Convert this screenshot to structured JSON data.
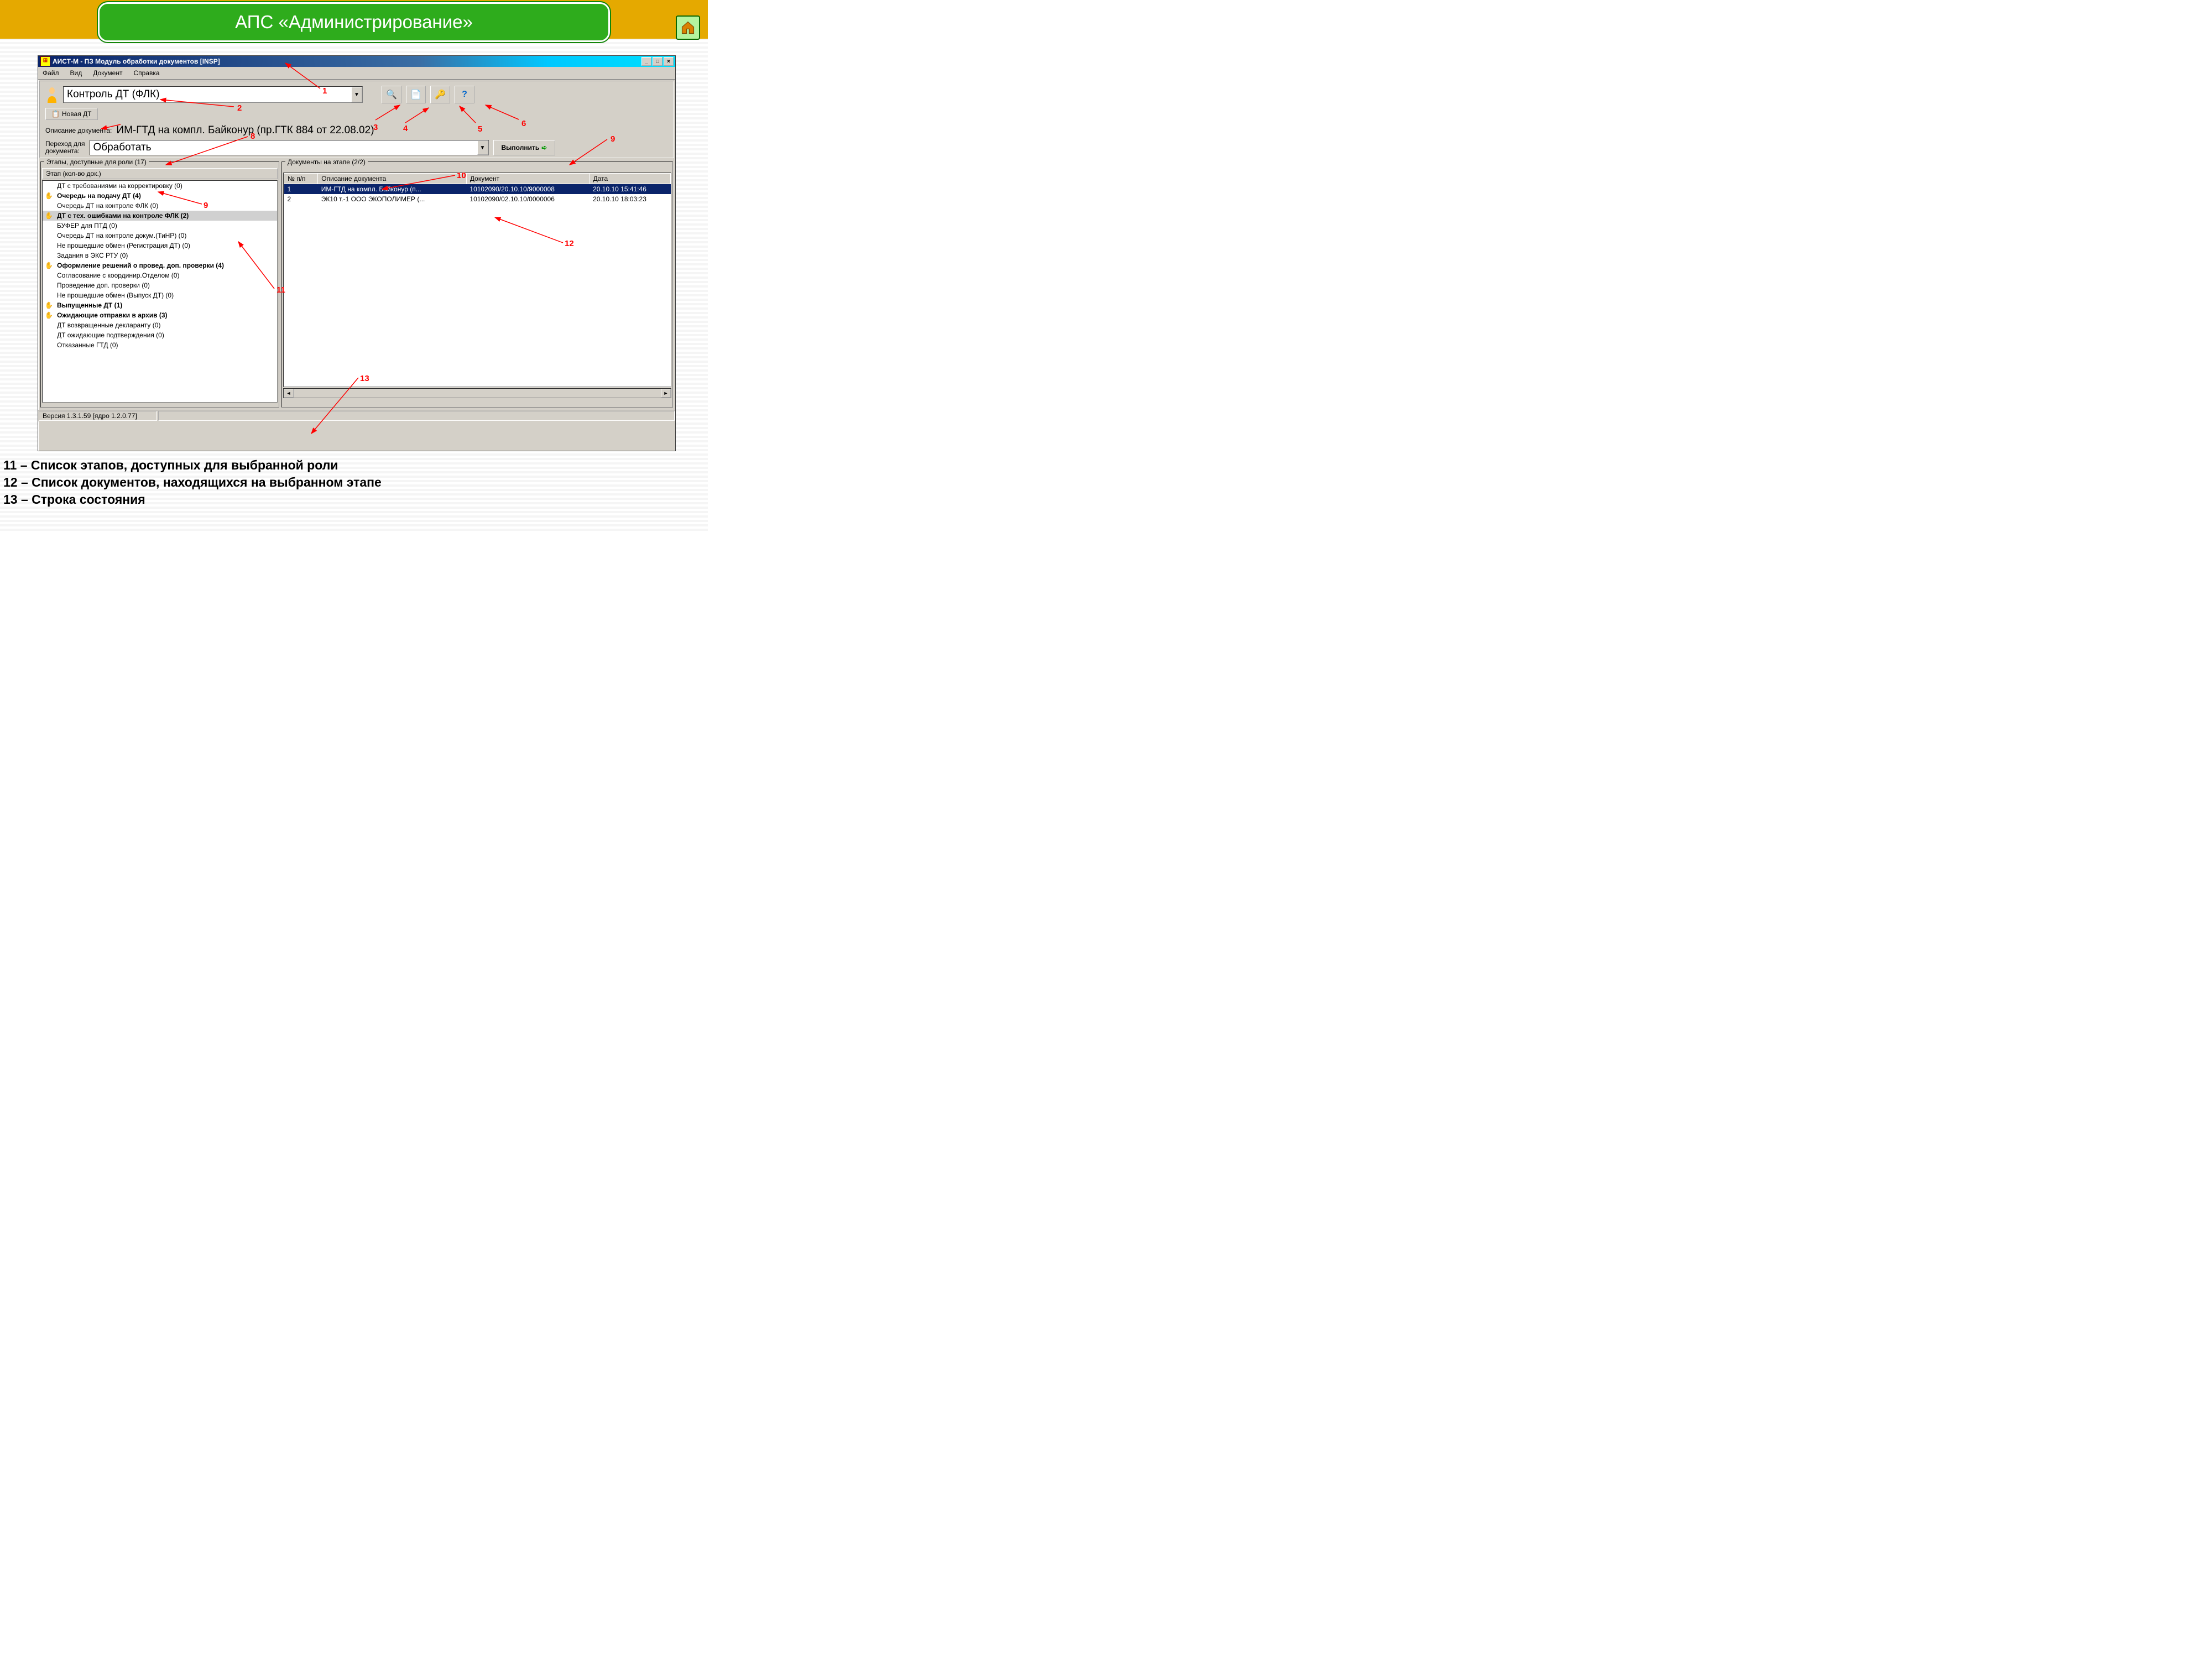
{
  "slide": {
    "title": "АПС «Администрирование»"
  },
  "home_icon_color": "#d98200",
  "window": {
    "title": "АИСТ-М - ПЗ Модуль обработки документов [INSP]",
    "menus": [
      "Файл",
      "Вид",
      "Документ",
      "Справка"
    ],
    "role_combo": "Контроль ДТ (ФЛК)",
    "new_btn": "Новая ДТ",
    "desc_label": "Описание документа:",
    "desc_text": "ИМ-ГТД на компл. Байконур (пр.ГТК 884 от 22.08.02)",
    "trans_label1": "Переход для",
    "trans_label2": "документа:",
    "trans_combo": "Обработать",
    "exec_btn": "Выполнить",
    "left_caption": "Этапы, доступные для роли (17)",
    "left_header": "Этап (кол-во док.)",
    "stages": [
      {
        "label": "ДТ с требованиями на корректировку (0)",
        "bold": false,
        "icon": false
      },
      {
        "label": "Очередь на подачу ДТ (4)",
        "bold": true,
        "icon": true
      },
      {
        "label": "Очередь ДТ на контроле ФЛК (0)",
        "bold": false,
        "icon": false
      },
      {
        "label": "ДТ с тех. ошибками на контроле ФЛК (2)",
        "bold": true,
        "icon": true,
        "selected": true
      },
      {
        "label": "БУФЕР для ПТД (0)",
        "bold": false,
        "icon": false
      },
      {
        "label": "Очередь ДТ на контроле докум.(ТиНР) (0)",
        "bold": false,
        "icon": false
      },
      {
        "label": "Не прошедшие обмен (Регистрация ДТ) (0)",
        "bold": false,
        "icon": false
      },
      {
        "label": "Задания в ЭКС РТУ (0)",
        "bold": false,
        "icon": false
      },
      {
        "label": "Оформление решений о провед. доп. проверки (4)",
        "bold": true,
        "icon": true
      },
      {
        "label": "Согласование с координир.Отделом (0)",
        "bold": false,
        "icon": false
      },
      {
        "label": "Проведение доп. проверки (0)",
        "bold": false,
        "icon": false
      },
      {
        "label": "Не прошедшие обмен (Выпуск ДТ) (0)",
        "bold": false,
        "icon": false
      },
      {
        "label": "Выпущенные ДТ (1)",
        "bold": true,
        "icon": true
      },
      {
        "label": "Ожидающие отправки в архив (3)",
        "bold": true,
        "icon": true
      },
      {
        "label": "ДТ возвращенные декларанту (0)",
        "bold": false,
        "icon": false
      },
      {
        "label": "ДТ ожидающие подтверждения (0)",
        "bold": false,
        "icon": false
      },
      {
        "label": "Отказанные ГТД (0)",
        "bold": false,
        "icon": false
      }
    ],
    "right_caption": "Документы на этапе (2/2)",
    "columns": [
      "№ п/п",
      "Описание документа",
      "Документ",
      "Дата"
    ],
    "rows": [
      {
        "n": "1",
        "desc": "ИМ-ГТД на компл. Байконур (п...",
        "doc": "10102090/20.10.10/9000008",
        "date": "20.10.10 15:41:46",
        "selected": true
      },
      {
        "n": "2",
        "desc": "ЭК10 т.-1 ООО ЭКОПОЛИМЕР (...",
        "doc": "10102090/02.10.10/0000006",
        "date": "20.10.10 18:03:23",
        "selected": false
      }
    ],
    "status": "Версия 1.3.1.59 [ядро 1.2.0.77]"
  },
  "annotations": {
    "a1": "1",
    "a2": "2",
    "a3": "3",
    "a4": "4",
    "a5": "5",
    "a6": "6",
    "a8": "8",
    "a9a": "9",
    "a9b": "9",
    "a10": "10",
    "a11": "11",
    "a12": "12",
    "a13": "13"
  },
  "captions": {
    "c11": "11 – Список этапов, доступных для выбранной роли",
    "c12": "12 – Список документов, находящихся на выбранном этапе",
    "c13": "13 – Строка состояния"
  }
}
